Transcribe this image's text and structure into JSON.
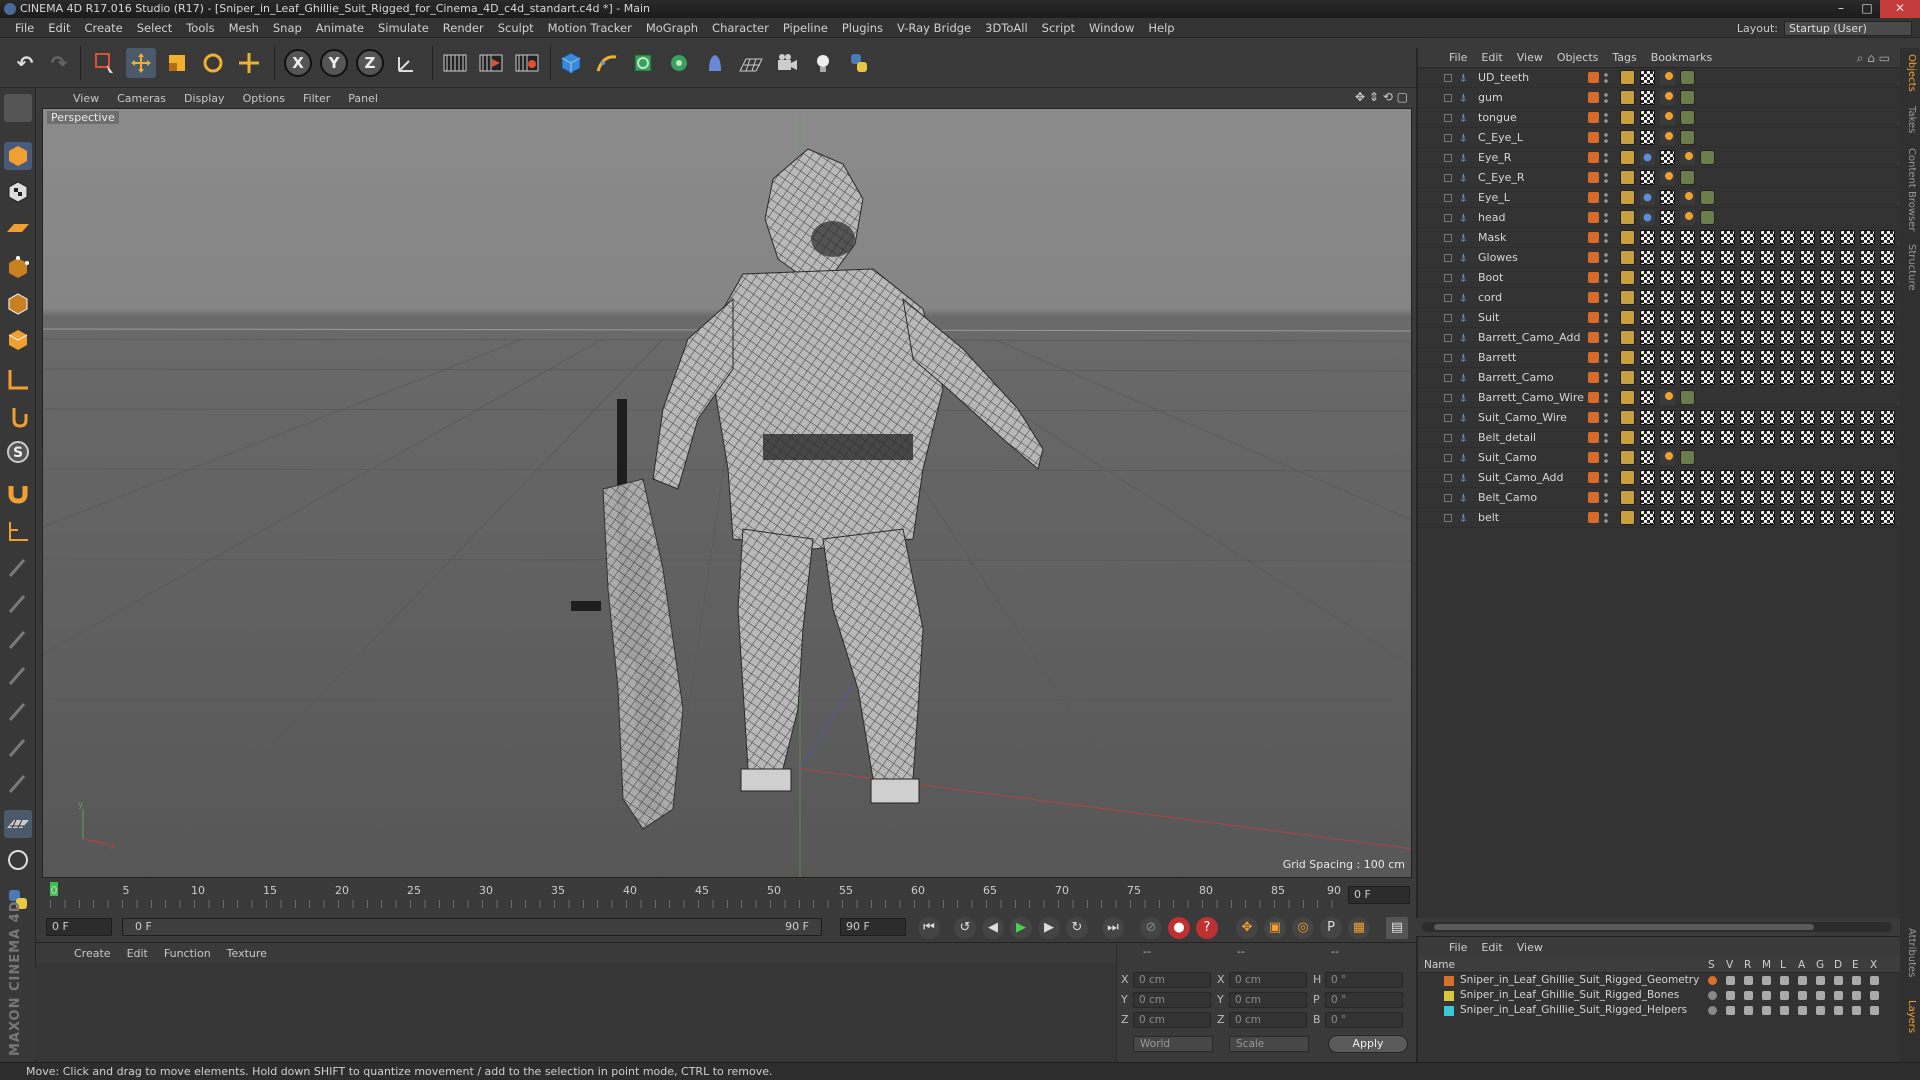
{
  "window": {
    "title": "CINEMA 4D R17.016 Studio (R17) - [Sniper_in_Leaf_Ghillie_Suit_Rigged_for_Cinema_4D_c4d_standart.c4d *] - Main",
    "controls": [
      "–",
      "□",
      "✕"
    ]
  },
  "menubar": {
    "items": [
      "File",
      "Edit",
      "Create",
      "Select",
      "Tools",
      "Mesh",
      "Snap",
      "Animate",
      "Simulate",
      "Render",
      "Sculpt",
      "Motion Tracker",
      "MoGraph",
      "Character",
      "Pipeline",
      "Plugins",
      "V-Ray Bridge",
      "3DToAll",
      "Script",
      "Window",
      "Help"
    ],
    "layout_label": "Layout:",
    "layout_value": "Startup (User)"
  },
  "toolbar": {
    "axis_x": "X",
    "axis_y": "Y",
    "axis_z": "Z"
  },
  "viewport": {
    "menu": [
      "View",
      "Cameras",
      "Display",
      "Options",
      "Filter",
      "Panel"
    ],
    "label": "Perspective",
    "grid_spacing": "Grid Spacing : 100 cm"
  },
  "timeline": {
    "ticks": [
      "0",
      "5",
      "10",
      "15",
      "20",
      "25",
      "30",
      "35",
      "40",
      "45",
      "50",
      "55",
      "60",
      "65",
      "70",
      "75",
      "80",
      "85",
      "90"
    ],
    "current_frame": "0 F"
  },
  "playback": {
    "start": "0 F",
    "range_start": "0 F",
    "range_end": "90 F",
    "end": "90 F"
  },
  "material_panel": {
    "menu": [
      "Create",
      "Edit",
      "Function",
      "Texture"
    ]
  },
  "coordinates": {
    "headers": [
      "--",
      "--",
      "--"
    ],
    "rows": [
      {
        "a_label": "X",
        "a_value": "0 cm",
        "b_label": "X",
        "b_value": "0 cm",
        "c_label": "H",
        "c_value": "0 °"
      },
      {
        "a_label": "Y",
        "a_value": "0 cm",
        "b_label": "Y",
        "b_value": "0 cm",
        "c_label": "P",
        "c_value": "0 °"
      },
      {
        "a_label": "Z",
        "a_value": "0 cm",
        "b_label": "Z",
        "b_value": "0 cm",
        "c_label": "B",
        "c_value": "0 °"
      }
    ],
    "mode": "World",
    "transform": "Scale",
    "apply": "Apply"
  },
  "object_manager": {
    "menu": [
      "File",
      "Edit",
      "View",
      "Objects",
      "Tags",
      "Bookmarks"
    ],
    "objects": [
      {
        "name": "UD_teeth",
        "tags": "short"
      },
      {
        "name": "gum",
        "tags": "short"
      },
      {
        "name": "tongue",
        "tags": "short"
      },
      {
        "name": "C_Eye_L",
        "tags": "short"
      },
      {
        "name": "Eye_R",
        "tags": "eye"
      },
      {
        "name": "C_Eye_R",
        "tags": "short"
      },
      {
        "name": "Eye_L",
        "tags": "eye"
      },
      {
        "name": "head",
        "tags": "eye"
      },
      {
        "name": "Mask",
        "tags": "long"
      },
      {
        "name": "Glowes",
        "tags": "long"
      },
      {
        "name": "Boot",
        "tags": "long"
      },
      {
        "name": "cord",
        "tags": "long"
      },
      {
        "name": "Suit",
        "tags": "long"
      },
      {
        "name": "Barrett_Camo_Add",
        "tags": "long"
      },
      {
        "name": "Barrett",
        "tags": "long"
      },
      {
        "name": "Barrett_Camo",
        "tags": "long"
      },
      {
        "name": "Barrett_Camo_Wire",
        "tags": "wire"
      },
      {
        "name": "Suit_Camo_Wire",
        "tags": "long"
      },
      {
        "name": "Belt_detail",
        "tags": "long"
      },
      {
        "name": "Suit_Camo",
        "tags": "short"
      },
      {
        "name": "Suit_Camo_Add",
        "tags": "long"
      },
      {
        "name": "Belt_Camo",
        "tags": "long"
      },
      {
        "name": "belt",
        "tags": "long"
      }
    ]
  },
  "layers": {
    "menu": [
      "File",
      "Edit",
      "View"
    ],
    "header_name": "Name",
    "header_cols": [
      "S",
      "V",
      "R",
      "M",
      "L",
      "A",
      "G",
      "D",
      "E",
      "X"
    ],
    "items": [
      {
        "name": "Sniper_in_Leaf_Ghillie_Suit_Rigged_Geometry",
        "color": "#d8702a"
      },
      {
        "name": "Sniper_in_Leaf_Ghillie_Suit_Rigged_Bones",
        "color": "#d6c83a"
      },
      {
        "name": "Sniper_in_Leaf_Ghillie_Suit_Rigged_Helpers",
        "color": "#3ac8d6"
      }
    ]
  },
  "right_tabs": [
    "Objects",
    "Takes",
    "Content Browser",
    "Structure",
    "Attributes",
    "Layers"
  ],
  "statusbar": {
    "text": "Move: Click and drag to move elements. Hold down SHIFT to quantize movement / add to the selection in point mode, CTRL to remove."
  },
  "logo": {
    "text": "MAXON CINEMA 4D"
  }
}
